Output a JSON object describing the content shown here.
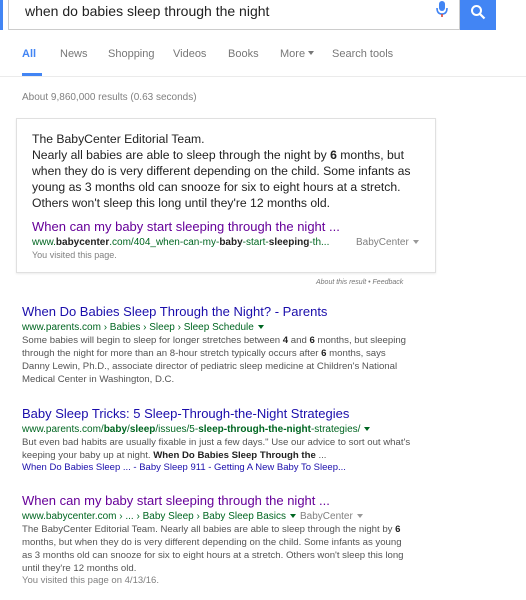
{
  "search": {
    "query": "when do babies sleep through the night"
  },
  "tabs": [
    {
      "label": "All",
      "active": true
    },
    {
      "label": "News"
    },
    {
      "label": "Shopping"
    },
    {
      "label": "Videos"
    },
    {
      "label": "Books"
    },
    {
      "label": "More"
    },
    {
      "label": "Search tools"
    }
  ],
  "stats": "About 9,860,000 results (0.63 seconds)",
  "featured_snippet": {
    "text_line1": "The BabyCenter Editorial Team.",
    "text_pre_bold": "Nearly all babies are able to sleep through the night by ",
    "text_bold": "6",
    "text_post_bold": " months, but when they do is very different depending on the child. Some infants as young as 3 months old can snooze for six to eight hours at a stretch. Others won't sleep this long until they're 12 months old.",
    "link_title": "When can my baby start sleeping through the night ...",
    "url_prefix": "www.",
    "url_bold1": "babycenter",
    "url_mid": ".com/404_when-can-my-",
    "url_bold2": "baby",
    "url_mid2": "-start-",
    "url_bold3": "sleeping",
    "url_end": "-th...",
    "source": "BabyCenter",
    "visited": "You visited this page.",
    "feedback": "About this result • Feedback"
  },
  "results": [
    {
      "title": "When Do Babies Sleep Through the Night? - Parents",
      "url": "www.parents.com › Babies › Sleep › Sleep Schedule",
      "desc_a": "Some babies will begin to sleep for longer stretches between ",
      "desc_b1": "4",
      "desc_c": " and ",
      "desc_b2": "6",
      "desc_d": " months, but sleeping through the night for more than an 8-hour stretch typically occurs after ",
      "desc_b3": "6",
      "desc_e": " months, says Danny Lewin, Ph.D., associate director of pediatric sleep medicine at Children's National Medical Center in Washington, D.C."
    },
    {
      "title": "Baby Sleep Tricks: 5 Sleep-Through-the-Night Strategies",
      "url_a": "www.parents.com/",
      "url_b1": "baby",
      "url_c": "/",
      "url_b2": "sleep",
      "url_d": "/issues/5-",
      "url_b3": "sleep-through-the-night",
      "url_e": "-strategies/",
      "desc_a": "But even bad habits are usually fixable in just a few days.\" Use our advice to sort out what's keeping your baby up at night. ",
      "desc_b": "When Do Babies Sleep Through the",
      "desc_c": " ...",
      "links": "When Do Babies Sleep ... - Baby Sleep 911 - Getting A New Baby To Sleep..."
    },
    {
      "title": "When can my baby start sleeping through the night ...",
      "url": "www.babycenter.com › ... › Baby Sleep › Baby Sleep Basics",
      "source": "BabyCenter",
      "desc_a": "The BabyCenter Editorial Team. Nearly all babies are able to sleep through the night by ",
      "desc_b1": "6",
      "desc_c": " months, but when they do is very different depending on the child. Some infants as young as 3 months old can snooze for six to eight hours at a stretch. Others won't sleep this long until they're 12 months old.",
      "visited": "You visited this page on 4/13/16."
    }
  ],
  "colors": {
    "accent": "#4285f4",
    "link": "#1a0dab",
    "visited_link": "#660099",
    "url_green": "#006621"
  }
}
